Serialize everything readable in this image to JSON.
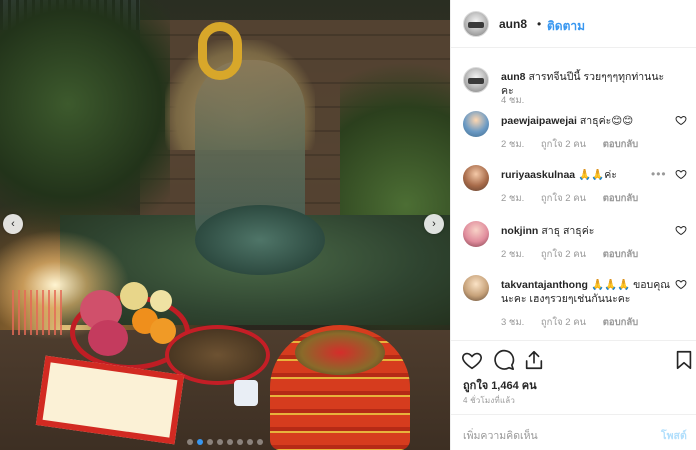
{
  "post": {
    "username": "aun8",
    "separator": "•",
    "follow_label": "ติดตาม",
    "carousel": {
      "current_index": 1,
      "total": 8
    }
  },
  "caption": {
    "username": "aun8",
    "text": "สารทจีนปีนี้ รวยๆๆๆทุกท่านนะคะ",
    "time": "4 ชม."
  },
  "comments": [
    {
      "username": "paewjaipawejai",
      "text": "สาธุค่ะ😊😊",
      "time": "2 ชม.",
      "likes": "ถูกใจ 2 คน",
      "reply": "ตอบกลับ"
    },
    {
      "username": "ruriyaaskulnaa",
      "text": "🙏🙏ค่ะ",
      "time": "2 ชม.",
      "likes": "ถูกใจ 2 คน",
      "reply": "ตอบกลับ",
      "more": "•••"
    },
    {
      "username": "nokjinn",
      "text": "สาธุ สาธุค่ะ",
      "time": "2 ชม.",
      "likes": "ถูกใจ 2 คน",
      "reply": "ตอบกลับ"
    },
    {
      "username": "takvantajanthong",
      "text": "🙏🙏🙏 ขอบคุณนะคะ เฮงๆรวยๆเช่นกันนะคะ",
      "time": "3 ชม.",
      "likes": "ถูกใจ 2 คน",
      "reply": "ตอบกลับ"
    }
  ],
  "stats": {
    "likes_text": "ถูกใจ 1,464 คน",
    "time_ago": "4 ชั่วโมงที่แล้ว"
  },
  "add_comment": {
    "placeholder": "เพิ่มความคิดเห็น",
    "post_label": "โพสต์"
  },
  "colors": {
    "accent": "#3897f0",
    "post_disabled": "#b2dffc",
    "muted": "#999999",
    "text": "#262626"
  },
  "icons": [
    "heart-icon",
    "comment-icon",
    "share-icon",
    "bookmark-icon",
    "chevron-left-icon",
    "chevron-right-icon"
  ]
}
